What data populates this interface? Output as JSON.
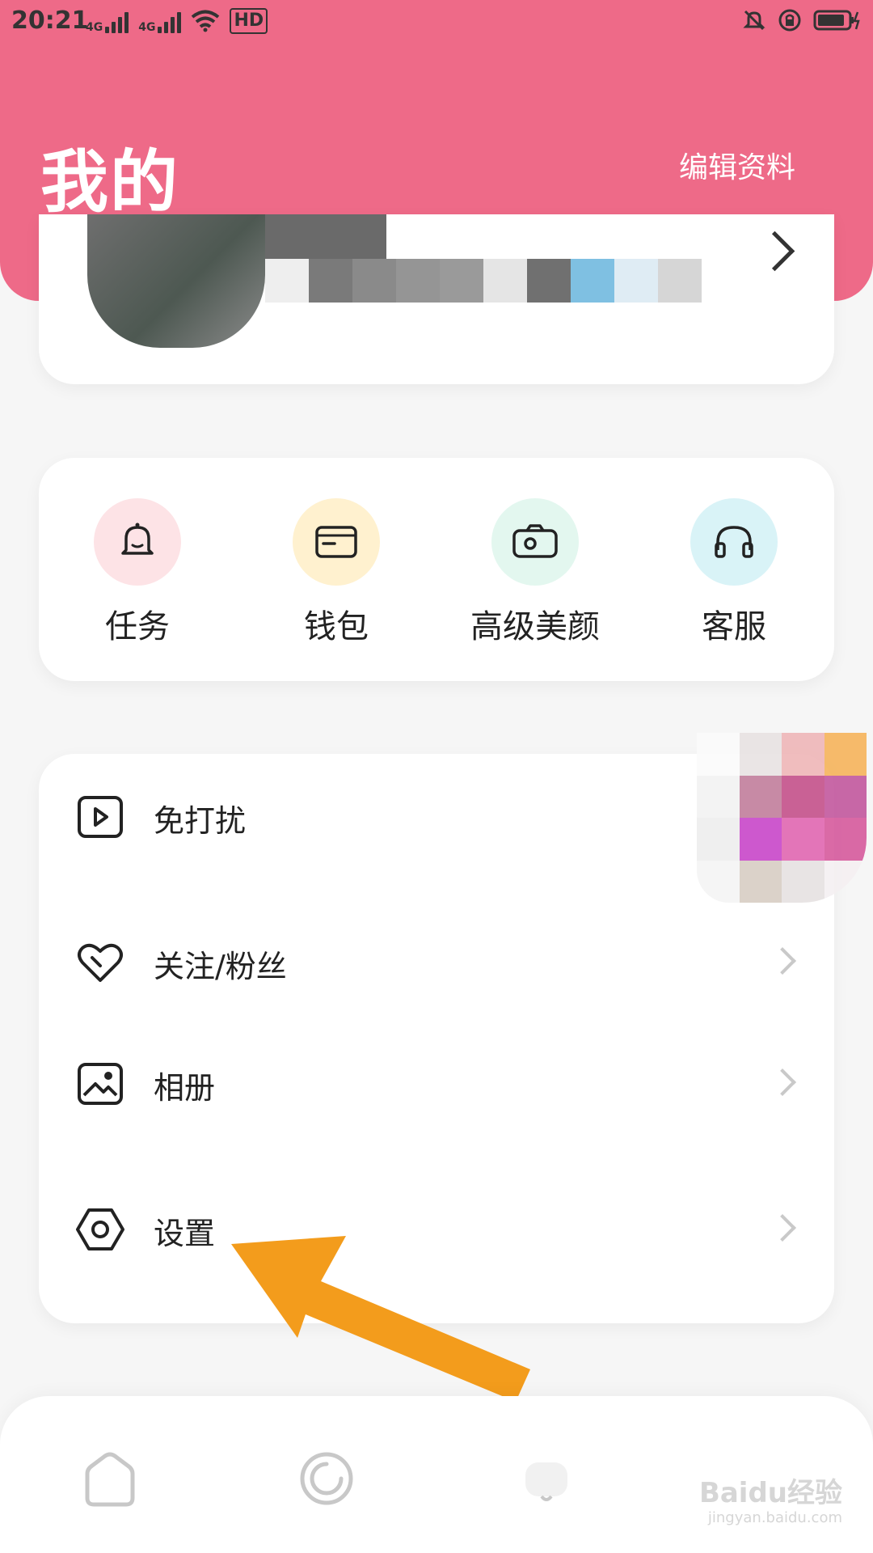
{
  "status_bar": {
    "time": "20:21",
    "network_1": "4G",
    "network_2": "4G",
    "hd_label": "HD"
  },
  "header": {
    "title": "我的",
    "edit_profile": "编辑资料",
    "accent_color": "#ee6a88"
  },
  "quick_actions": [
    {
      "label": "任务",
      "icon": "bell-icon",
      "bg": "#fde3e6"
    },
    {
      "label": "钱包",
      "icon": "wallet-icon",
      "bg": "#fff1cf"
    },
    {
      "label": "高级美颜",
      "icon": "camera-icon",
      "bg": "#e3f7ef"
    },
    {
      "label": "客服",
      "icon": "headphones-icon",
      "bg": "#d9f3f7"
    }
  ],
  "menu": [
    {
      "label": "免打扰",
      "icon": "play-square-icon",
      "has_chevron": false
    },
    {
      "label": "关注/粉丝",
      "icon": "heart-icon",
      "has_chevron": true
    },
    {
      "label": "相册",
      "icon": "image-icon",
      "has_chevron": true
    },
    {
      "label": "设置",
      "icon": "hexagon-settings-icon",
      "has_chevron": true
    }
  ],
  "bottom_nav": [
    {
      "icon": "home-icon"
    },
    {
      "icon": "refresh-icon"
    },
    {
      "icon": "profile-icon"
    }
  ],
  "watermark": {
    "brand": "Baidu经验",
    "url": "jingyan.baidu.com"
  }
}
